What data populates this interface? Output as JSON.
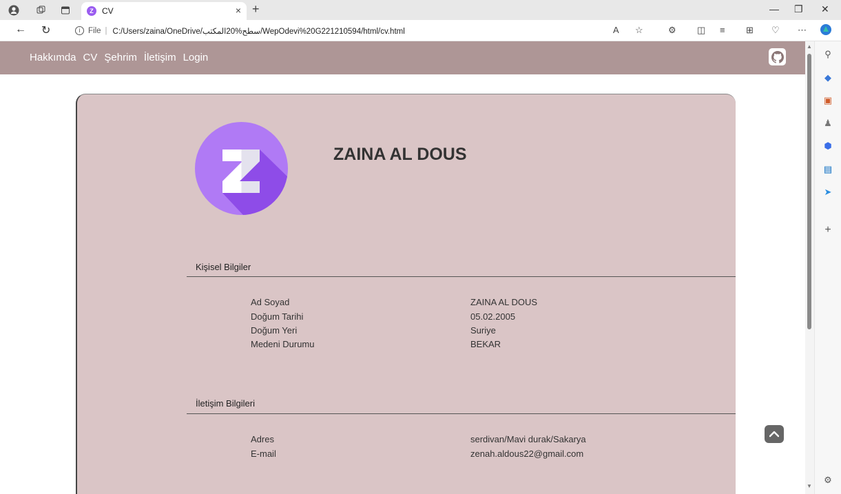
{
  "browser": {
    "tab_title": "CV",
    "tab_favicon": "Z",
    "address_prefix": "File",
    "address": "C:/Users/zaina/OneDrive/سطح%20المكتب/WepOdevi%20G221210594/html/cv.html"
  },
  "nav": {
    "links": [
      "Hakkımda",
      "CV",
      "Şehrim",
      "İletişim",
      "Login"
    ]
  },
  "profile": {
    "name": "ZAINA AL DOUS",
    "avatar_letter": "Z",
    "avatar_color": "#9a5cf0"
  },
  "sections": {
    "personal": {
      "title": "Kişisel Bilgiler",
      "rows": [
        {
          "label": "Ad Soyad",
          "value": "ZAINA AL DOUS"
        },
        {
          "label": "Doğum Tarihi",
          "value": "05.02.2005"
        },
        {
          "label": "Doğum Yeri",
          "value": "Suriye"
        },
        {
          "label": "Medeni Durumu",
          "value": "BEKAR"
        }
      ]
    },
    "contact": {
      "title": "İletişim Bilgileri",
      "rows": [
        {
          "label": "Adres",
          "value": "serdivan/Mavi durak/Sakarya"
        },
        {
          "label": "E-mail",
          "value": "zenah.aldous22@gmail.com"
        }
      ]
    }
  },
  "colors": {
    "nav_bg": "#ae9696",
    "card_bg": "#dac5c6"
  }
}
